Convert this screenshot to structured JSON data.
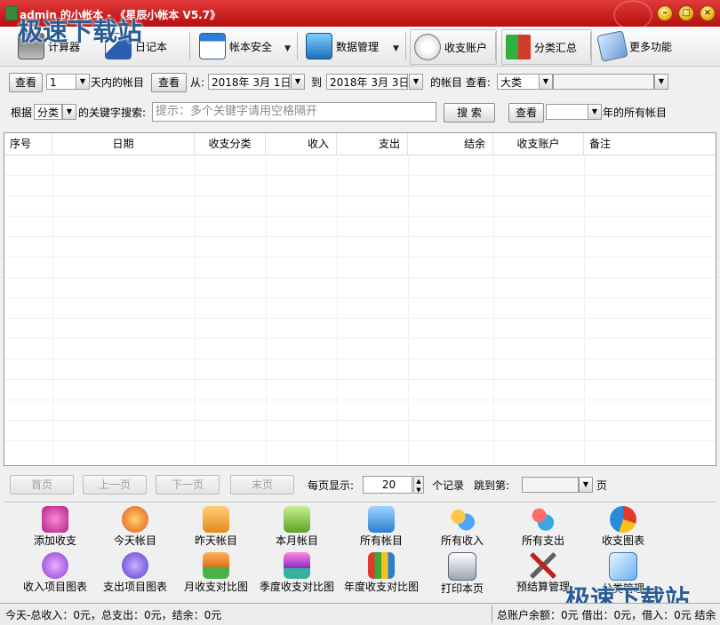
{
  "window": {
    "title": "admin 的小帐本 - 《星辰小帐本 V5.7》"
  },
  "watermark": {
    "text": "极速下载站"
  },
  "toolbar": {
    "calculator": "计算器",
    "diary": "日记本",
    "account_security": "帐本安全",
    "data_management": "数据管理",
    "payment_accounts": "收支账户",
    "category_summary": "分类汇总",
    "more_functions": "更多功能"
  },
  "filter_row1": {
    "view_button": "查看",
    "days_value": "1",
    "days_label": "天内的帐目",
    "view_button2": "查看",
    "from_label": "从:",
    "from_date": "2018年  3月  1日",
    "to_label": "到",
    "to_date": "2018年  3月  3日",
    "accounts_label": "的帐目 查看:",
    "category_level": "大类",
    "category_value": ""
  },
  "filter_row2": {
    "by_label": "根据",
    "by_value": "分类",
    "keyword_label": "的关键字搜索:",
    "search_placeholder": "提示：多个关键字请用空格隔开",
    "search_button": "搜 索",
    "view_button": "查看",
    "year_value": "",
    "year_label": "年的所有帐目"
  },
  "table": {
    "columns": [
      "序号",
      "日期",
      "收支分类",
      "收入",
      "支出",
      "结余",
      "收支账户",
      "备注"
    ],
    "rows": []
  },
  "pager": {
    "first": "首页",
    "prev": "上一页",
    "next": "下一页",
    "last": "末页",
    "per_page_label": "每页显示:",
    "per_page_value": "20",
    "records_label": "个记录",
    "jump_label": "跳到第:",
    "jump_value": "",
    "page_label": "页"
  },
  "panel": {
    "row1": [
      "添加收支",
      "今天帐目",
      "昨天帐目",
      "本月帐目",
      "所有帐目",
      "所有收入",
      "所有支出",
      "收支图表"
    ],
    "row2": [
      "收入项目图表",
      "支出项目图表",
      "月收支对比图",
      "季度收支对比图",
      "年度收支对比图",
      "打印本页",
      "预结算管理",
      "分类管理"
    ]
  },
  "status": {
    "left": "今天-总收入：0元，总支出：0元，结余：0元",
    "right": "总账户余额：0元  借出：0元，借入：0元  结余"
  },
  "colors": {
    "title_bar": "#c81a1a",
    "watermark": "#2a5d96"
  }
}
